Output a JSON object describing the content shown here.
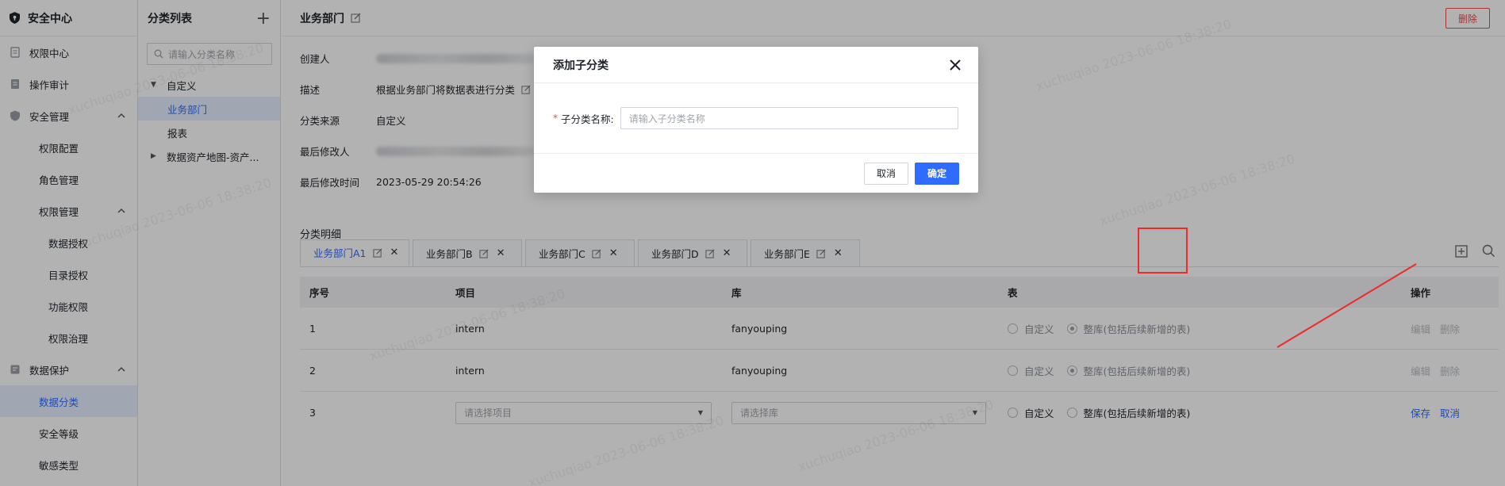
{
  "app": {
    "title": "安全中心"
  },
  "sidebar": {
    "items": [
      {
        "label": "权限中心",
        "icon": "doc-icon"
      },
      {
        "label": "操作审计",
        "icon": "list-icon"
      },
      {
        "label": "安全管理",
        "icon": "shield-icon",
        "expanded": true
      },
      {
        "label": "权限配置"
      },
      {
        "label": "角色管理"
      },
      {
        "label": "权限管理",
        "expanded": true
      },
      {
        "label": "数据授权"
      },
      {
        "label": "目录授权"
      },
      {
        "label": "功能权限"
      },
      {
        "label": "权限治理"
      },
      {
        "label": "数据保护",
        "icon": "database-icon",
        "expanded": true
      },
      {
        "label": "数据分类",
        "active": true
      },
      {
        "label": "安全等级"
      },
      {
        "label": "敏感类型"
      }
    ]
  },
  "catpanel": {
    "title": "分类列表",
    "add_symbol": "+",
    "search_placeholder": "请输入分类名称",
    "tree": [
      {
        "label": "自定义",
        "expanded": true
      },
      {
        "label": "业务部门",
        "active": true
      },
      {
        "label": "报表"
      },
      {
        "label": "数据资产地图-资产..."
      }
    ]
  },
  "main": {
    "title": "业务部门",
    "delete_label": "删除",
    "info": [
      {
        "label": "创建人",
        "value": ""
      },
      {
        "label": "描述",
        "value": "根据业务部门将数据表进行分类"
      },
      {
        "label": "分类来源",
        "value": "自定义"
      },
      {
        "label": "最后修改人",
        "value": ""
      },
      {
        "label": "最后修改时间",
        "value": "2023-05-29 20:54:26"
      }
    ],
    "section_title": "分类明细",
    "tabs": [
      "业务部门A1",
      "业务部门B",
      "业务部门C",
      "业务部门D",
      "业务部门E"
    ],
    "table": {
      "headers": [
        "序号",
        "项目",
        "库",
        "表",
        "操作"
      ],
      "rows": [
        {
          "index": "1",
          "project": "intern",
          "db": "fanyouping",
          "opt_custom": "自定义",
          "opt_all": "整库(包括后续新增的表)",
          "action1": "编辑",
          "action2": "删除"
        },
        {
          "index": "2",
          "project": "intern",
          "db": "fanyouping",
          "opt_custom": "自定义",
          "opt_all": "整库(包括后续新增的表)",
          "action1": "编辑",
          "action2": "删除"
        },
        {
          "index": "3",
          "project_placeholder": "请选择项目",
          "db_placeholder": "请选择库",
          "opt_custom": "自定义",
          "opt_all": "整库(包括后续新增的表)",
          "action1": "保存",
          "action2": "取消"
        }
      ]
    }
  },
  "modal": {
    "title": "添加子分类",
    "required_mark": "*",
    "field_label": "子分类名称:",
    "placeholder": "请输入子分类名称",
    "cancel_label": "取消",
    "ok_label": "确定"
  },
  "watermark": "xuchuqiao 2023-06-06 18:38:20",
  "colors": {
    "accent": "#2f6bff",
    "danger": "#f04a4a",
    "annotation": "#ee2b2b"
  }
}
